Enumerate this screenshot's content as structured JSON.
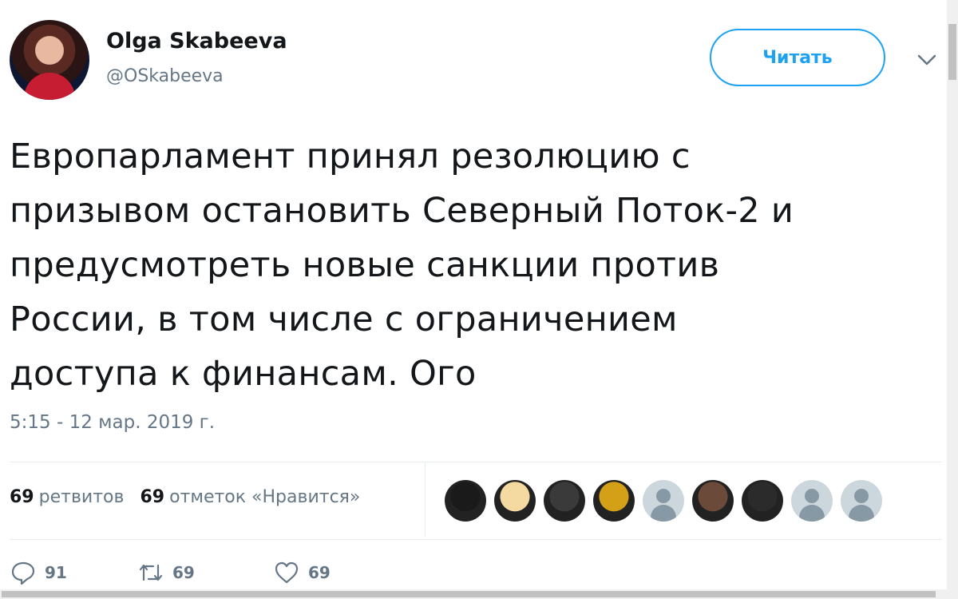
{
  "author": {
    "name": "Olga Skabeeva",
    "handle": "@OSkabeeva"
  },
  "follow_button": "Читать",
  "tweet_text": [
    "Европарламент принял резолюцию с",
    "призывом остановить Северный Поток-2 и",
    "предусмотреть новые санкции против",
    "России, в том числе с ограничением",
    "доступа к финансам. Ого"
  ],
  "timestamp": "5:15 - 12 мар. 2019 г.",
  "stats": {
    "retweets_count": "69",
    "retweets_label": "ретвитов",
    "likes_count": "69",
    "likes_label": "отметок «Нравится»"
  },
  "likers": [
    {
      "icon": "dark-night-avatar",
      "color": "#1a1a1a"
    },
    {
      "icon": "cartoon-angel-avatar",
      "color": "#f4d9a0"
    },
    {
      "icon": "bw-portrait-avatar",
      "color": "#3a3a3a"
    },
    {
      "icon": "coat-of-arms-avatar",
      "color": "#d4a017"
    },
    {
      "icon": "default-avatar",
      "color": "#ccd6dd"
    },
    {
      "icon": "man-portrait-avatar",
      "color": "#6b4a3a"
    },
    {
      "icon": "bird-cartoon-avatar",
      "color": "#2b2b2b"
    },
    {
      "icon": "default-avatar",
      "color": "#ccd6dd"
    },
    {
      "icon": "default-avatar",
      "color": "#ccd6dd"
    }
  ],
  "actions": {
    "reply_count": "91",
    "retweet_count": "69",
    "like_count": "69"
  },
  "colors": {
    "accent": "#1da1f2",
    "muted": "#657786",
    "text": "#14171a"
  }
}
